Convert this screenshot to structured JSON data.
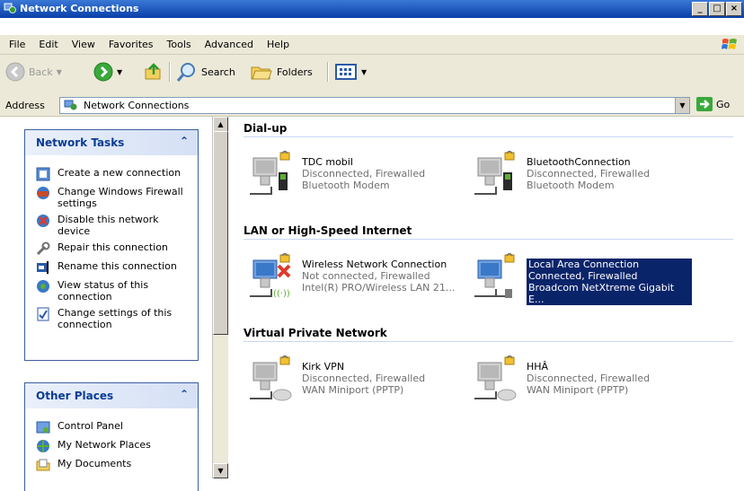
{
  "window": {
    "title": "Network Connections",
    "buttons": [
      "_",
      "□",
      "×"
    ]
  },
  "menu": [
    {
      "label": "File"
    },
    {
      "label": "Edit"
    },
    {
      "label": "View"
    },
    {
      "label": "Favorites"
    },
    {
      "label": "Tools"
    },
    {
      "label": "Advanced"
    },
    {
      "label": "Help"
    }
  ],
  "toolbar": {
    "back_label": "Back",
    "search_label": "Search",
    "folders_label": "Folders"
  },
  "address": {
    "label": "Address",
    "value": "Network Connections",
    "go_label": "Go"
  },
  "left_panels": {
    "network_tasks": {
      "title": "Network Tasks",
      "items": [
        {
          "label": "Create a new connection",
          "icon": "new-connection-icon"
        },
        {
          "label": "Change Windows Firewall settings",
          "icon": "firewall-icon"
        },
        {
          "label": "Disable this network device",
          "icon": "disable-icon"
        },
        {
          "label": "Repair this connection",
          "icon": "repair-icon"
        },
        {
          "label": "Rename this connection",
          "icon": "rename-icon"
        },
        {
          "label": "View status of this connection",
          "icon": "status-icon"
        },
        {
          "label": "Change settings of this connection",
          "icon": "settings-icon"
        }
      ]
    },
    "other_places": {
      "title": "Other Places",
      "items": [
        {
          "label": "Control Panel",
          "icon": "control-panel-icon"
        },
        {
          "label": "My Network Places",
          "icon": "network-places-icon"
        },
        {
          "label": "My Documents",
          "icon": "documents-icon"
        }
      ]
    }
  },
  "groups": {
    "dialup": {
      "title": "Dial-up",
      "items": [
        {
          "name": "TDC mobil",
          "status": "Disconnected, Firewalled",
          "device": "Bluetooth Modem"
        },
        {
          "name": "BluetoothConnection",
          "status": "Disconnected, Firewalled",
          "device": "Bluetooth Modem"
        }
      ]
    },
    "lan": {
      "title": "LAN or High-Speed Internet",
      "items": [
        {
          "name": "Wireless Network Connection",
          "status": "Not connected, Firewalled",
          "device": "Intel(R) PRO/Wireless LAN 21..."
        },
        {
          "name": "Local Area Connection",
          "status": "Connected, Firewalled",
          "device": "Broadcom NetXtreme Gigabit E...",
          "selected": true
        }
      ]
    },
    "vpn": {
      "title": "Virtual Private Network",
      "items": [
        {
          "name": "Kirk VPN",
          "status": "Disconnected, Firewalled",
          "device": "WAN Miniport (PPTP)"
        },
        {
          "name": "HHÂ",
          "status": "Disconnected, Firewalled",
          "device": "WAN Miniport (PPTP)"
        }
      ]
    }
  },
  "colors": {
    "titlebar": "#0a3fa8",
    "selection": "#0a246a",
    "panel_title": "#0b3c94"
  }
}
